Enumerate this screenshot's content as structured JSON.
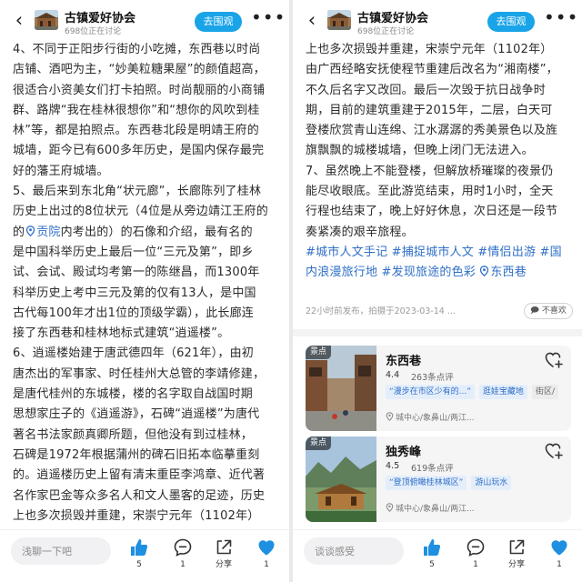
{
  "header": {
    "group_name": "古镇爱好协会",
    "group_sub": "698位正在讨论",
    "follow_label": "去围观"
  },
  "left": {
    "lines": [
      "4、不同于正阳步行街的小吃摊，东西巷以时尚",
      "店铺、酒吧为主，“妙美粒糖果屋”的颜值超高，",
      "很适合小资美女们打卡拍照。时尚靓丽的小商铺",
      "群、路牌“我在桂林很想你”和“想你的风吹到桂",
      "林”等，都是拍照点。东西巷北段是明靖王府的",
      "城墙，距今已有600多年历史，是国内保存最完",
      "好的藩王府城墙。",
      "5、最后来到东北角“状元廊”，长廊陈列了桂林",
      "历史上出过的8位状元（4位是从旁边靖江王府的",
      "",
      "是中国科举历史上最后一位“三元及第”，即乡",
      "试、会试、殿试均考第一的陈继昌，而1300年",
      "科举历史上考中三元及第的仅有13人，是中国",
      "古代每100年才出1位的顶级学霸），此长廊连",
      "接了东西巷和桂林地标式建筑“逍遥楼”。",
      "6、逍遥楼始建于唐武德四年（621年），由初",
      "唐杰出的军事家、时任桂州大总管的李靖修建，",
      "是唐代桂州的东城楼，楼的名字取自战国时期",
      "思想家庄子的《逍遥游》，石碑“逍遥楼”为唐代",
      "著名书法家颜真卿所题，但他没有到过桂林，",
      "石碑是1972年根据蒲州的碑石旧拓本临摹重刻",
      "的。逍遥楼历史上留有清末重臣李鸿章、近代著",
      "名作家巴金等众多名人和文人墨客的足迹，历史",
      "上也多次损毁并重建，宋崇宁元年（1102年）"
    ],
    "line10_pre": "的",
    "line10_loc": "贡院",
    "line10_post": "内考出的）的石像和介绍，最有名的"
  },
  "right": {
    "lines": [
      "上也多次损毁并重建，宋崇宁元年（1102年）",
      "由广西经略安抚使程节重建后改名为“湘南楼”，",
      "不久后名字又改回。最后一次毁于抗日战争时",
      "期，目前的建筑重建于2015年，二层，白天可",
      "登楼欣赏青山连绵、江水潺潺的秀美景色以及旌",
      "旗飘飘的城楼城墙，但晚上闭门无法进入。",
      "7、虽然晚上不能登楼，但解放桥璀璨的夜景仍",
      "能尽收眼底。至此游览结束，用时1小时，全天",
      "行程也结束了，晚上好好休息，次日还是一段节",
      "奏紧凑的艰辛旅程。"
    ],
    "tags_line1": "#城市人文手记 #捕捉城市人文 #情侣出游 #国",
    "tags_line2_pre": "内浪漫旅行地 #发现旅途的色彩 ",
    "tags_line2_loc": "东西巷",
    "meta": "22小时前发布，拍摄于2023-03-14 ...",
    "dislike_label": "不喜欢"
  },
  "poi": [
    {
      "badge": "景点",
      "name": "东西巷",
      "rating": "4.4",
      "reviews": "263条点评",
      "chips": [
        "“漫步在市区少有的...”",
        "逛娃宝藏地",
        "街区/"
      ],
      "address": "城中心/象鼻山/两江..."
    },
    {
      "badge": "景点",
      "name": "独秀峰",
      "rating": "4.5",
      "reviews": "619条点评",
      "chips": [
        "“登顶俯瞰桂林城区”",
        "游山玩水"
      ],
      "address": "城中心/象鼻山/两江..."
    }
  ],
  "bottom": {
    "left_placeholder": "浅聊一下吧",
    "right_placeholder": "谈谈感受",
    "like_count": "5",
    "comment_count": "1",
    "share_label": "分享",
    "fav_count": "1"
  },
  "colors": {
    "follow_button": "#19a4e8",
    "link_blue": "#2f6fc6",
    "like_blue": "#1e8fe1",
    "fav_blue": "#1e8fe1"
  },
  "icons": [
    "back-arrow-icon",
    "group-avatar",
    "more-icon",
    "location-pin-icon",
    "heart-add-icon",
    "thumbs-up-icon",
    "comment-icon",
    "share-icon",
    "favorite-heart-icon"
  ]
}
